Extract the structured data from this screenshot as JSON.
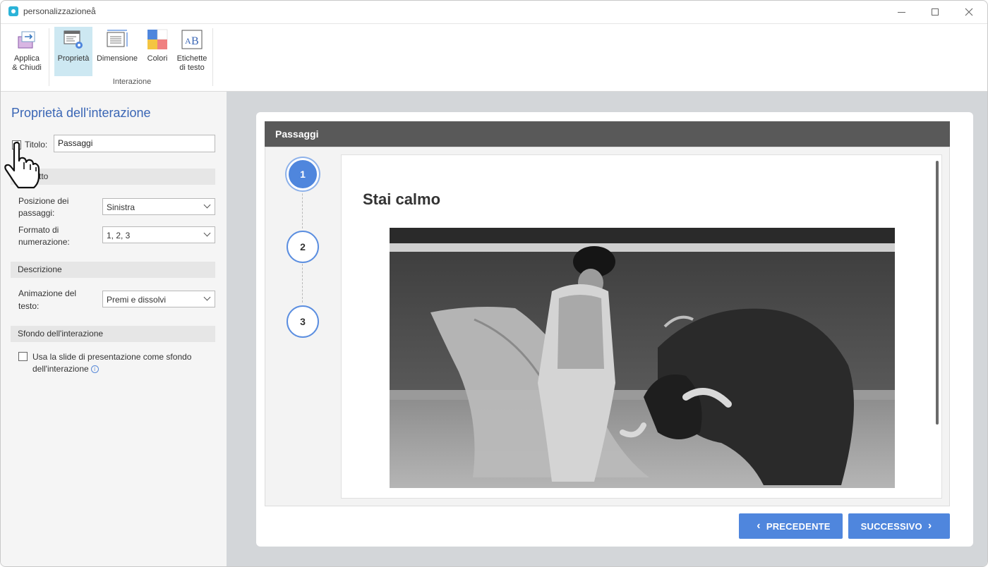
{
  "window": {
    "title": "personalizzazioneå",
    "icons": [
      "app-icon",
      "minimize-icon",
      "maximize-icon",
      "close-icon"
    ]
  },
  "ribbon": {
    "apply": {
      "line1": "Applica",
      "line2": "& Chiudi",
      "icon": "apply-close-icon"
    },
    "properties": {
      "label": "Proprietà",
      "icon": "properties-icon",
      "active": true
    },
    "dimension": {
      "label": "Dimensione",
      "icon": "dimension-icon"
    },
    "colors": {
      "label": "Colori",
      "icon": "colors-icon"
    },
    "labels": {
      "line1": "Etichette",
      "line2": "di testo",
      "icon": "text-labels-icon"
    },
    "group_label": "Interazione"
  },
  "panel": {
    "title": "Proprietà dell'interazione",
    "title_checkbox": {
      "label": "Titolo:",
      "checked": true,
      "value": "Passaggi"
    },
    "section_layout": "tto",
    "steps_position": {
      "label_line1": "Posizione dei",
      "label_line2": "passaggi:",
      "value": "Sinistra"
    },
    "numbering_format": {
      "label_line1": "Formato di",
      "label_line2": "numerazione:",
      "value": "1, 2, 3"
    },
    "section_description": "Descrizione",
    "text_animation": {
      "label_line1": "Animazione del",
      "label_line2": "testo:",
      "value": "Premi e dissolvi"
    },
    "section_background": "Sfondo dell'interazione",
    "slide_background": {
      "label_line1": "Usa la slide di presentazione come sfondo",
      "label_line2": "dell'interazione",
      "checked": false
    }
  },
  "preview": {
    "header": "Passaggi",
    "steps": [
      "1",
      "2",
      "3"
    ],
    "active_step": "1",
    "content_title": "Stai calmo",
    "image": "bullfighter-photo",
    "prev_label": "PRECEDENTE",
    "next_label": "SUCCESSIVO",
    "prev_icon": "chevron-left-icon",
    "next_icon": "chevron-right-icon"
  },
  "colors": {
    "accent": "#4f86dd",
    "panel_title": "#3a66b5",
    "header_bar": "#595959",
    "ribbon_active": "#cde8f2"
  }
}
